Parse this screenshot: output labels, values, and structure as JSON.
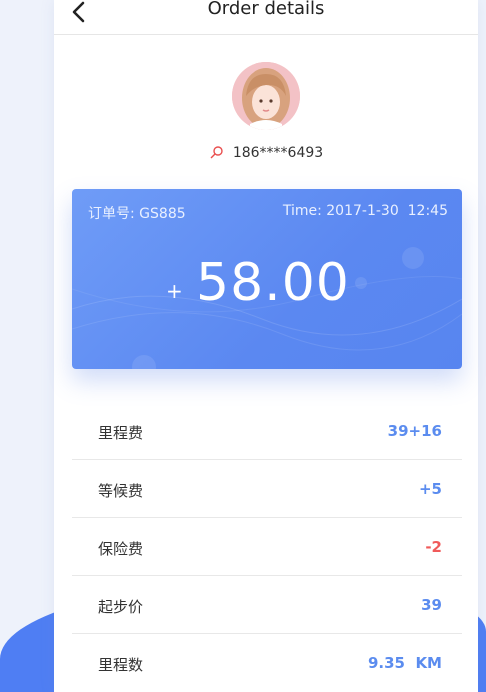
{
  "colors": {
    "accent": "#4f7ef3",
    "positive": "#5b8cef",
    "negative": "#f05a5a"
  },
  "header": {
    "title": "Order details",
    "back_icon": "chevron-left-icon"
  },
  "profile": {
    "avatar_icon": "user-avatar",
    "pin_icon": "map-pin-icon",
    "phone": "186****6493"
  },
  "card": {
    "order_label": "订单号:",
    "order_no": "GS885",
    "time_label": "Time:",
    "date": "2017-1-30",
    "clock": "12:45",
    "sign": "+",
    "amount": "58.00"
  },
  "fees": [
    {
      "label": "里程费",
      "value": "39+16",
      "tone": "positive"
    },
    {
      "label": "等候费",
      "value": "+5",
      "tone": "positive"
    },
    {
      "label": "保险费",
      "value": "-2",
      "tone": "negative"
    },
    {
      "label": "起步价",
      "value": "39",
      "tone": "positive"
    },
    {
      "label": "里程数",
      "value": "9.35  KM",
      "tone": "positive"
    }
  ]
}
